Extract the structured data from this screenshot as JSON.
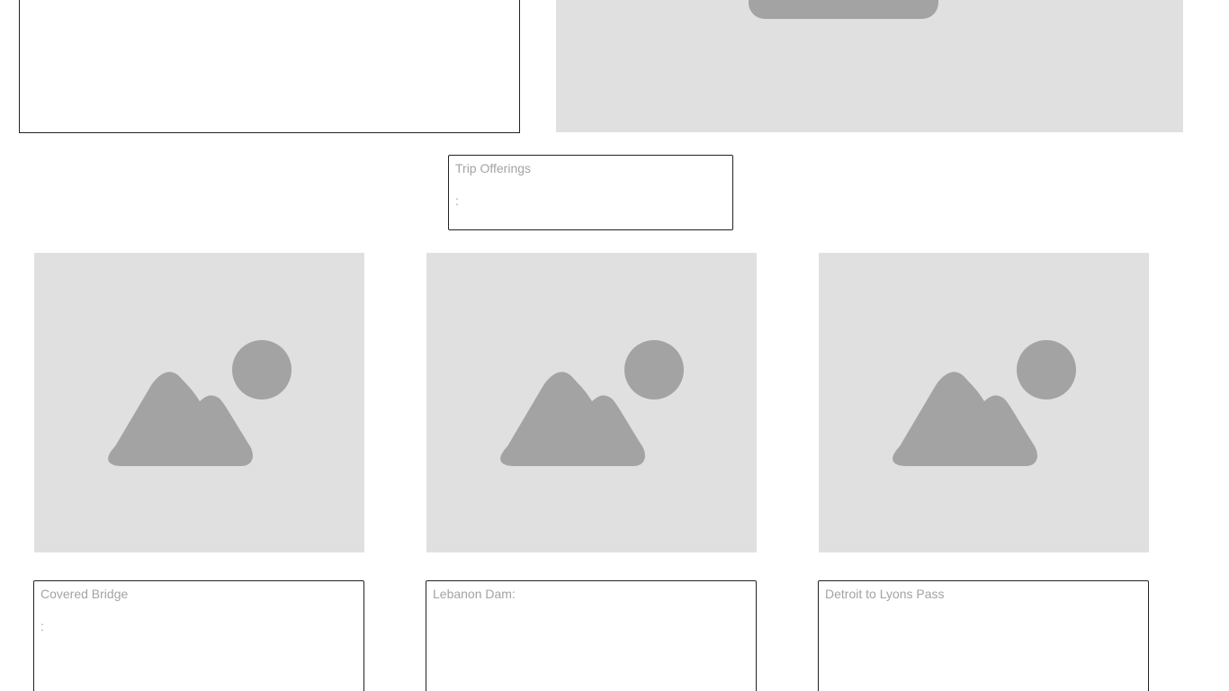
{
  "header": {
    "trip_offerings": {
      "title": "Trip Offerings",
      "line2": "",
      "line3": ":"
    }
  },
  "trips": [
    {
      "title": "Covered Bridge",
      "line2": "",
      "line3": ":"
    },
    {
      "title": "Lebanon Dam:",
      "line2": "",
      "line3": ""
    },
    {
      "title": "Detroit to Lyons Pass",
      "line2": "",
      "line3": ""
    }
  ],
  "icons": {
    "placeholder": "image-placeholder-icon"
  },
  "colors": {
    "placeholder_bg": "#e0e0e0",
    "placeholder_fg": "#a3a3a3",
    "text_muted": "#a3a3a3",
    "border": "#222222"
  }
}
